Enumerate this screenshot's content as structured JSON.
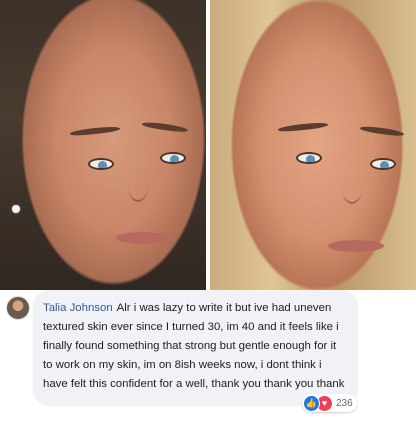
{
  "photos": {
    "before_label": "",
    "after_label": ""
  },
  "comment": {
    "author": "Talia Johnson",
    "text": "Alr i was lazy to write it but ive had uneven textured skin ever since I turned 30, im 40 and it feels like i finally found something that strong but gentle enough for it to work on my skin, im on 8ish weeks now, i dont think i have felt this confident for a well, thank you thank you thank",
    "reactions": {
      "icons": [
        "like-icon",
        "love-icon"
      ],
      "count": "236"
    }
  },
  "colors": {
    "author_link": "#385898",
    "bubble_bg": "#f0f2f5",
    "like_blue": "#1877f2",
    "love_red": "#f33e58"
  }
}
